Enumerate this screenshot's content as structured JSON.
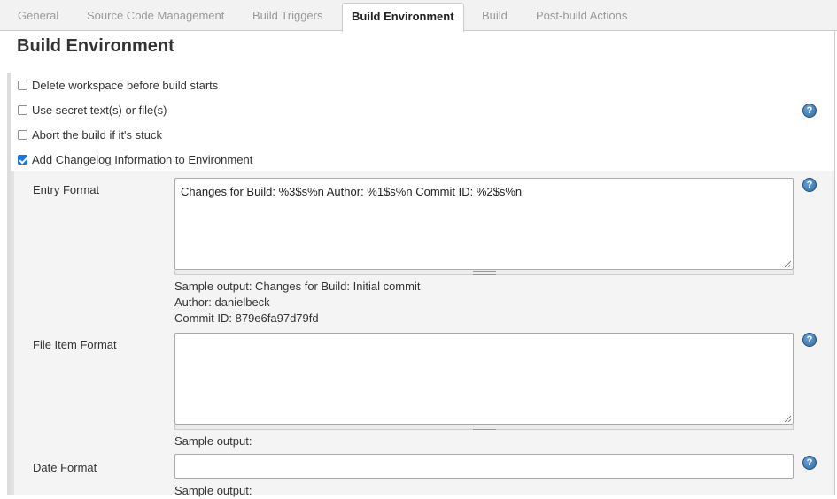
{
  "tabs": [
    {
      "label": "General"
    },
    {
      "label": "Source Code Management"
    },
    {
      "label": "Build Triggers"
    },
    {
      "label": "Build Environment"
    },
    {
      "label": "Build"
    },
    {
      "label": "Post-build Actions"
    }
  ],
  "active_tab": "Build Environment",
  "section": {
    "title": "Build Environment"
  },
  "options": [
    {
      "label": "Delete workspace before build starts",
      "checked": false
    },
    {
      "label": "Use secret text(s) or file(s)",
      "checked": false
    },
    {
      "label": "Abort the build if it's stuck",
      "checked": false
    },
    {
      "label": "Add Changelog Information to Environment",
      "checked": true
    }
  ],
  "help_icon_glyph": "?",
  "changelog": {
    "entry_format": {
      "label": "Entry Format",
      "value": "Changes for Build: %3$s%n Author: %1$s%n Commit ID: %2$s%n",
      "sample_line1": "Sample output: Changes for Build: Initial commit",
      "sample_line2": "Author: danielbeck",
      "sample_line3": "Commit ID: 879e6fa97d79fd"
    },
    "file_item_format": {
      "label": "File Item Format",
      "value": "",
      "sample": "Sample output:"
    },
    "date_format": {
      "label": "Date Format",
      "value": "",
      "sample": "Sample output:"
    }
  },
  "colors": {
    "checkbox_checked": "#1a73e8",
    "help_icon": "#2d6aa6",
    "tab_inactive_text": "#999999"
  }
}
